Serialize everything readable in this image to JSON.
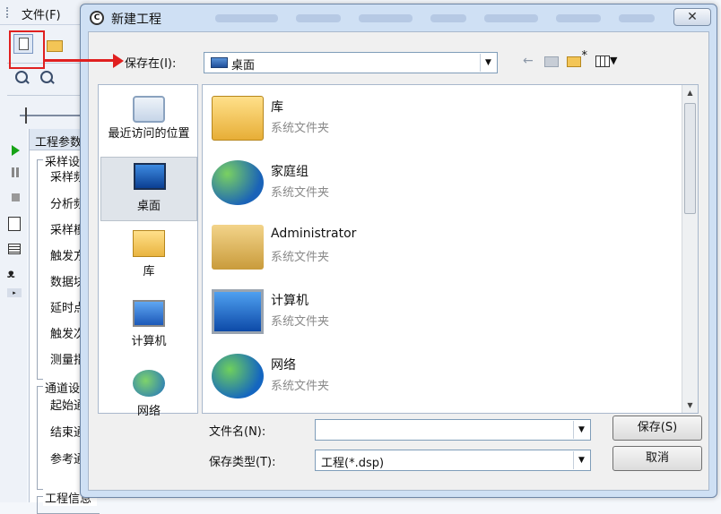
{
  "app": {
    "menu_file": "文件(F)",
    "panel_title": "工程参数",
    "sampling_group": "采样设置",
    "sampling_rows": [
      "采样频率",
      "分析频率",
      "采样模式",
      "触发方式",
      "数据块数",
      "延时点数",
      "触发次数",
      "测量指标"
    ],
    "channel_group": "通道设置",
    "channel_rows": [
      "起始通道",
      "结束通道",
      "参考通道"
    ],
    "project_group": "工程信息"
  },
  "dialog": {
    "title": "新建工程",
    "close_glyph": "✕",
    "save_in_label": "保存在(I):",
    "location": "桌面",
    "places": [
      "最近访问的位置",
      "桌面",
      "库",
      "计算机",
      "网络"
    ],
    "items": [
      {
        "name": "库",
        "type": "系统文件夹",
        "icon": "library-icon"
      },
      {
        "name": "家庭组",
        "type": "系统文件夹",
        "icon": "homegroup-icon"
      },
      {
        "name": "Administrator",
        "type": "系统文件夹",
        "icon": "user-folder-icon"
      },
      {
        "name": "计算机",
        "type": "系统文件夹",
        "icon": "computer-icon"
      },
      {
        "name": "网络",
        "type": "系统文件夹",
        "icon": "network-icon"
      }
    ],
    "filename_label": "文件名(N):",
    "filename_value": "",
    "filetype_label": "保存类型(T):",
    "filetype_value": "工程(*.dsp)",
    "save_button": "保存(S)",
    "cancel_button": "取消"
  },
  "colors": {
    "annotation": "#e02020",
    "dialog_frame": "#cfe0f4"
  }
}
